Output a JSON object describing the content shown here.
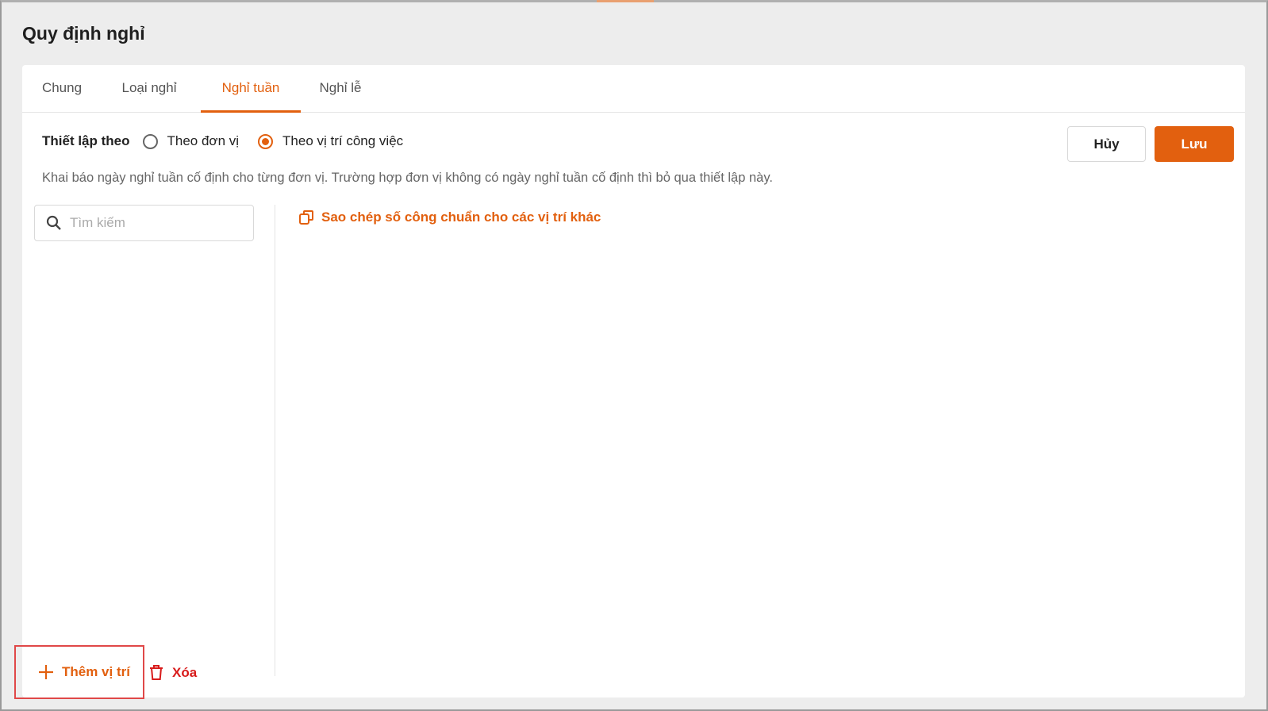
{
  "page": {
    "title": "Quy định nghỉ"
  },
  "tabs": [
    {
      "label": "Chung"
    },
    {
      "label": "Loại nghỉ"
    },
    {
      "label": "Nghỉ tuần",
      "active": true
    },
    {
      "label": "Nghỉ lễ"
    }
  ],
  "settings": {
    "label": "Thiết lập theo",
    "options": [
      {
        "label": "Theo đơn vị",
        "selected": false
      },
      {
        "label": "Theo vị trí công việc",
        "selected": true
      }
    ],
    "description": "Khai báo ngày nghỉ tuần cố định cho từng đơn vị. Trường hợp đơn vị không có ngày nghỉ tuần cố định thì bỏ qua thiết lập này."
  },
  "actions": {
    "cancel": "Hủy",
    "save": "Lưu"
  },
  "search": {
    "placeholder": "Tìm kiếm",
    "value": ""
  },
  "copy_link": "Sao chép số công chuẩn cho các vị trí khác",
  "footer": {
    "add": "Thêm vị trí",
    "delete": "Xóa"
  },
  "colors": {
    "accent": "#e2600f",
    "danger": "#d81b1b"
  }
}
